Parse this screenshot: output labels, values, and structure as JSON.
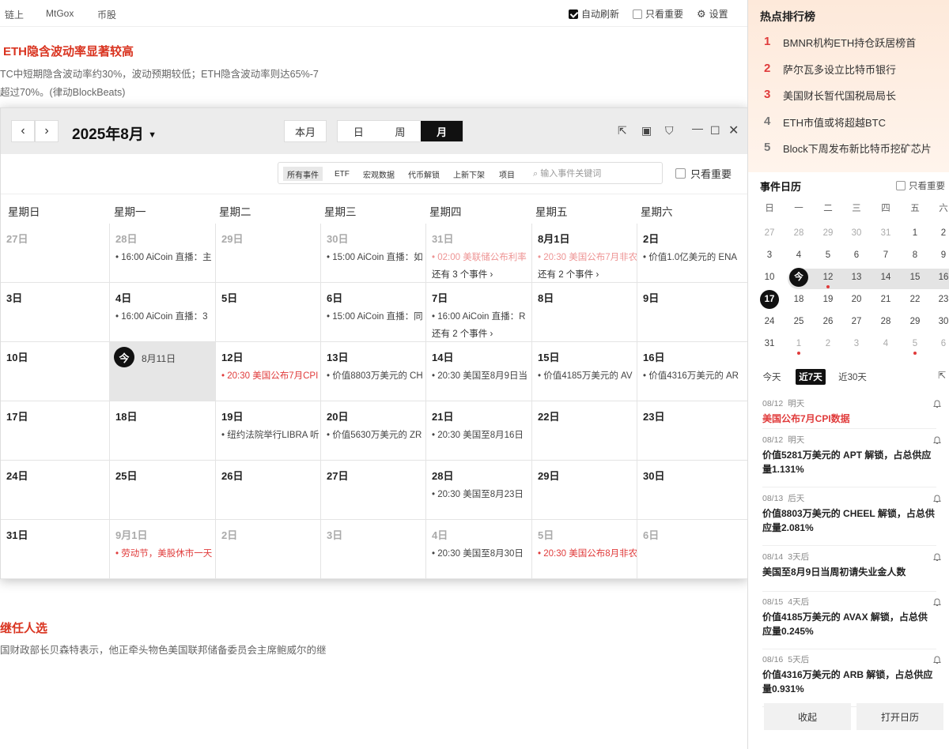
{
  "topnav": {
    "links": [
      "链上",
      "MtGox",
      "币股"
    ],
    "auto_refresh": "自动刷新",
    "only_important": "只看重要",
    "settings": "设置"
  },
  "news": [
    {
      "title": "ETH隐含波动率显著较高",
      "lines": [
        "TC中短期隐含波动率约30%，波动预期较低；ETH隐含波动率则达65%-7",
        "超过70%。(律动BlockBeats)"
      ]
    },
    {
      "title": "继任人选",
      "lines": [
        "国财政部长贝森特表示，他正牵头物色美国联邦储备委员会主席鲍威尔的继"
      ]
    }
  ],
  "calendar": {
    "title": "2025年8月",
    "this_month": "本月",
    "views": [
      "日",
      "周",
      "月"
    ],
    "active_view": "月",
    "filters": [
      "所有事件",
      "ETF",
      "宏观数据",
      "代币解锁",
      "上新下架",
      "项目"
    ],
    "search_placeholder": "输入事件关键词",
    "only_important": "只看重要",
    "weekdays": [
      "星期日",
      "星期一",
      "星期二",
      "星期三",
      "星期四",
      "星期五",
      "星期六"
    ],
    "today_badge": "今",
    "today_label": "8月11日",
    "weeks": [
      [
        {
          "d": "27日",
          "o": true,
          "ev": "",
          "red": false
        },
        {
          "d": "28日",
          "o": true,
          "ev": "16:00 AiCoin 直播：主",
          "red": false
        },
        {
          "d": "29日",
          "o": true,
          "ev": "",
          "red": false
        },
        {
          "d": "30日",
          "o": true,
          "ev": "15:00 AiCoin 直播：如",
          "red": false
        },
        {
          "d": "31日",
          "o": true,
          "ev": "02:00 美联储公布利率",
          "red": true,
          "faded": true,
          "more": "还有 3 个事件 ›"
        },
        {
          "d": "8月1日",
          "o": false,
          "ev": "20:30 美国公布7月非农",
          "red": true,
          "faded": true,
          "more": "还有 2 个事件 ›"
        },
        {
          "d": "2日",
          "o": false,
          "ev": "价值1.0亿美元的 ENA",
          "red": false
        }
      ],
      [
        {
          "d": "3日",
          "o": false,
          "ev": ""
        },
        {
          "d": "4日",
          "o": false,
          "ev": "16:00 AiCoin 直播：3"
        },
        {
          "d": "5日",
          "o": false,
          "ev": ""
        },
        {
          "d": "6日",
          "o": false,
          "ev": "15:00 AiCoin 直播：同"
        },
        {
          "d": "7日",
          "o": false,
          "ev": "16:00 AiCoin 直播：R",
          "more": "还有 2 个事件 ›"
        },
        {
          "d": "8日",
          "o": false,
          "ev": ""
        },
        {
          "d": "9日",
          "o": false,
          "ev": ""
        }
      ],
      [
        {
          "d": "10日",
          "o": false,
          "ev": ""
        },
        {
          "d": "",
          "today": true,
          "ev": ""
        },
        {
          "d": "12日",
          "o": false,
          "ev": "20:30 美国公布7月CPI",
          "red": true
        },
        {
          "d": "13日",
          "o": false,
          "ev": "价值8803万美元的 CH"
        },
        {
          "d": "14日",
          "o": false,
          "ev": "20:30 美国至8月9日当"
        },
        {
          "d": "15日",
          "o": false,
          "ev": "价值4185万美元的 AV"
        },
        {
          "d": "16日",
          "o": false,
          "ev": "价值4316万美元的 AR"
        }
      ],
      [
        {
          "d": "17日",
          "o": false,
          "ev": ""
        },
        {
          "d": "18日",
          "o": false,
          "ev": ""
        },
        {
          "d": "19日",
          "o": false,
          "ev": "纽约法院举行LIBRA 听"
        },
        {
          "d": "20日",
          "o": false,
          "ev": "价值5630万美元的 ZR"
        },
        {
          "d": "21日",
          "o": false,
          "ev": "20:30 美国至8月16日"
        },
        {
          "d": "22日",
          "o": false,
          "ev": ""
        },
        {
          "d": "23日",
          "o": false,
          "ev": ""
        }
      ],
      [
        {
          "d": "24日",
          "o": false,
          "ev": ""
        },
        {
          "d": "25日",
          "o": false,
          "ev": ""
        },
        {
          "d": "26日",
          "o": false,
          "ev": ""
        },
        {
          "d": "27日",
          "o": false,
          "ev": ""
        },
        {
          "d": "28日",
          "o": false,
          "ev": "20:30 美国至8月23日"
        },
        {
          "d": "29日",
          "o": false,
          "ev": ""
        },
        {
          "d": "30日",
          "o": false,
          "ev": ""
        }
      ],
      [
        {
          "d": "31日",
          "o": false,
          "ev": ""
        },
        {
          "d": "9月1日",
          "o": true,
          "ev": "劳动节，美股休市一天",
          "red": true
        },
        {
          "d": "2日",
          "o": true,
          "ev": ""
        },
        {
          "d": "3日",
          "o": true,
          "ev": ""
        },
        {
          "d": "4日",
          "o": true,
          "ev": "20:30 美国至8月30日"
        },
        {
          "d": "5日",
          "o": true,
          "ev": "20:30 美国公布8月非农",
          "red": true
        },
        {
          "d": "6日",
          "o": true,
          "ev": ""
        }
      ]
    ]
  },
  "hot": {
    "title": "热点排行榜",
    "items": [
      {
        "rank": "1",
        "text": "BMNR机构ETH持仓跃居榜首",
        "red": true
      },
      {
        "rank": "2",
        "text": "萨尔瓦多设立比特币银行",
        "red": true
      },
      {
        "rank": "3",
        "text": "美国财长暂代国税局局长",
        "red": true
      },
      {
        "rank": "4",
        "text": "ETH市值或将超越BTC",
        "red": false
      },
      {
        "rank": "5",
        "text": "Block下周发布新比特币挖矿芯片",
        "red": false
      }
    ]
  },
  "event_calendar": {
    "title": "事件日历",
    "only_important": "只看重要",
    "weekdays": [
      "日",
      "一",
      "二",
      "三",
      "四",
      "五",
      "六"
    ],
    "rows": [
      [
        [
          "27",
          1,
          0
        ],
        [
          "28",
          1,
          0
        ],
        [
          "29",
          1,
          0
        ],
        [
          "30",
          1,
          0
        ],
        [
          "31",
          1,
          0
        ],
        [
          "1",
          0,
          0
        ],
        [
          "2",
          0,
          0
        ]
      ],
      [
        [
          "3",
          0,
          0
        ],
        [
          "4",
          0,
          0
        ],
        [
          "5",
          0,
          0
        ],
        [
          "6",
          0,
          0
        ],
        [
          "7",
          0,
          0
        ],
        [
          "8",
          0,
          0
        ],
        [
          "9",
          0,
          0
        ]
      ],
      [
        [
          "10",
          0,
          0
        ],
        [
          "今",
          0,
          0
        ],
        [
          "12",
          0,
          1
        ],
        [
          "13",
          0,
          0
        ],
        [
          "14",
          0,
          0
        ],
        [
          "15",
          0,
          0
        ],
        [
          "16",
          0,
          0
        ]
      ],
      [
        [
          "17",
          0,
          0
        ],
        [
          "18",
          0,
          0
        ],
        [
          "19",
          0,
          0
        ],
        [
          "20",
          0,
          0
        ],
        [
          "21",
          0,
          0
        ],
        [
          "22",
          0,
          0
        ],
        [
          "23",
          0,
          0
        ]
      ],
      [
        [
          "24",
          0,
          0
        ],
        [
          "25",
          0,
          0
        ],
        [
          "26",
          0,
          0
        ],
        [
          "27",
          0,
          0
        ],
        [
          "28",
          0,
          0
        ],
        [
          "29",
          0,
          0
        ],
        [
          "30",
          0,
          0
        ]
      ],
      [
        [
          "31",
          0,
          0
        ],
        [
          "1",
          1,
          1
        ],
        [
          "2",
          1,
          0
        ],
        [
          "3",
          1,
          0
        ],
        [
          "4",
          1,
          0
        ],
        [
          "5",
          1,
          1
        ],
        [
          "6",
          1,
          0
        ]
      ]
    ],
    "tabs": [
      "今天",
      "近7天",
      "近30天"
    ],
    "active_tab": "近7天",
    "events": [
      {
        "date": "08/12",
        "rel": "明天",
        "text": "美国公布7月CPI数据",
        "red": true
      },
      {
        "date": "08/12",
        "rel": "明天",
        "text": "价值5281万美元的 APT 解锁，占总供应量1.131%",
        "red": false
      },
      {
        "date": "08/13",
        "rel": "后天",
        "text": "价值8803万美元的 CHEEL 解锁，占总供应量2.081%",
        "red": false
      },
      {
        "date": "08/14",
        "rel": "3天后",
        "text": "美国至8月9日当周初请失业金人数",
        "red": false
      },
      {
        "date": "08/15",
        "rel": "4天后",
        "text": "价值4185万美元的 AVAX 解锁，占总供应量0.245%",
        "red": false
      },
      {
        "date": "08/16",
        "rel": "5天后",
        "text": "价值4316万美元的 ARB 解锁，占总供应量0.931%",
        "red": false
      }
    ],
    "collapse": "收起",
    "open_calendar": "打开日历"
  },
  "colors": {
    "accent_red": "#e03b3b",
    "dark": "#111111"
  }
}
